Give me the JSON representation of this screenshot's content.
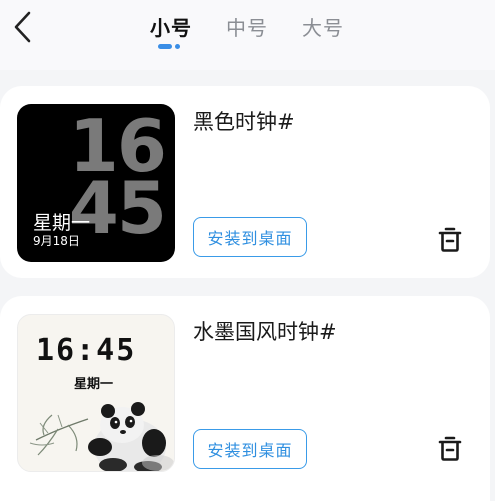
{
  "header": {
    "tabs": [
      {
        "label": "小号",
        "active": true
      },
      {
        "label": "中号",
        "active": false
      },
      {
        "label": "大号",
        "active": false
      }
    ]
  },
  "widgets": [
    {
      "title": "黑色时钟#",
      "install_label": "安装到桌面",
      "preview": {
        "hour": "16",
        "minute": "45",
        "weekday": "星期一",
        "date": "9月18日"
      }
    },
    {
      "title": "水墨国风时钟#",
      "install_label": "安装到桌面",
      "preview": {
        "time": "16:45",
        "weekday": "星期一"
      }
    }
  ],
  "colors": {
    "accent": "#3a9be8",
    "background": "#f4f5f7",
    "card": "#ffffff"
  }
}
